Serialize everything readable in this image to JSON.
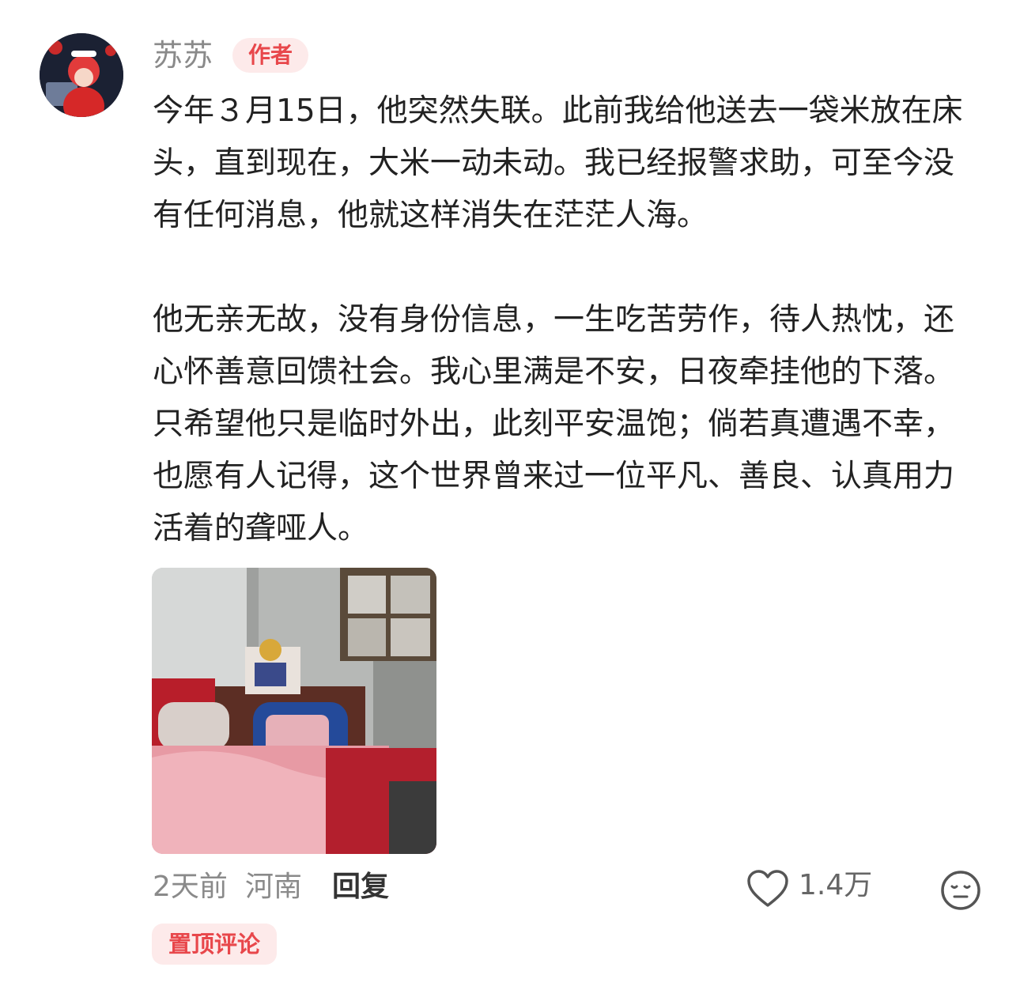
{
  "comment": {
    "author": "苏苏",
    "author_badge": "作者",
    "paragraphs": [
      "今年３月15日，他突然失联。此前我给他送去一袋米放在床头，直到现在，大米一动未动。我已经报警求助，可至今没有任何消息，他就这样消失在茫茫人海。",
      "他无亲无故，没有身份信息，一生吃苦劳作，待人热忱，还心怀善意回馈社会。我心里满是不安，日夜牵挂他的下落。只希望他只是临时外出，此刻平安温饱；倘若真遭遇不幸，也愿有人记得，这个世界曾来过一位平凡、善良、认真用力活着的聋哑人。"
    ],
    "time": "2天前",
    "location": "河南",
    "reply_label": "回复",
    "like_count": "1.4万",
    "pinned_label": "置顶评论",
    "icons": {
      "like": "heart-icon",
      "reaction": "neutral-face-icon"
    },
    "colors": {
      "accent": "#e8474b",
      "badge_bg": "#fdeaea",
      "meta": "#8a8a8a"
    }
  }
}
